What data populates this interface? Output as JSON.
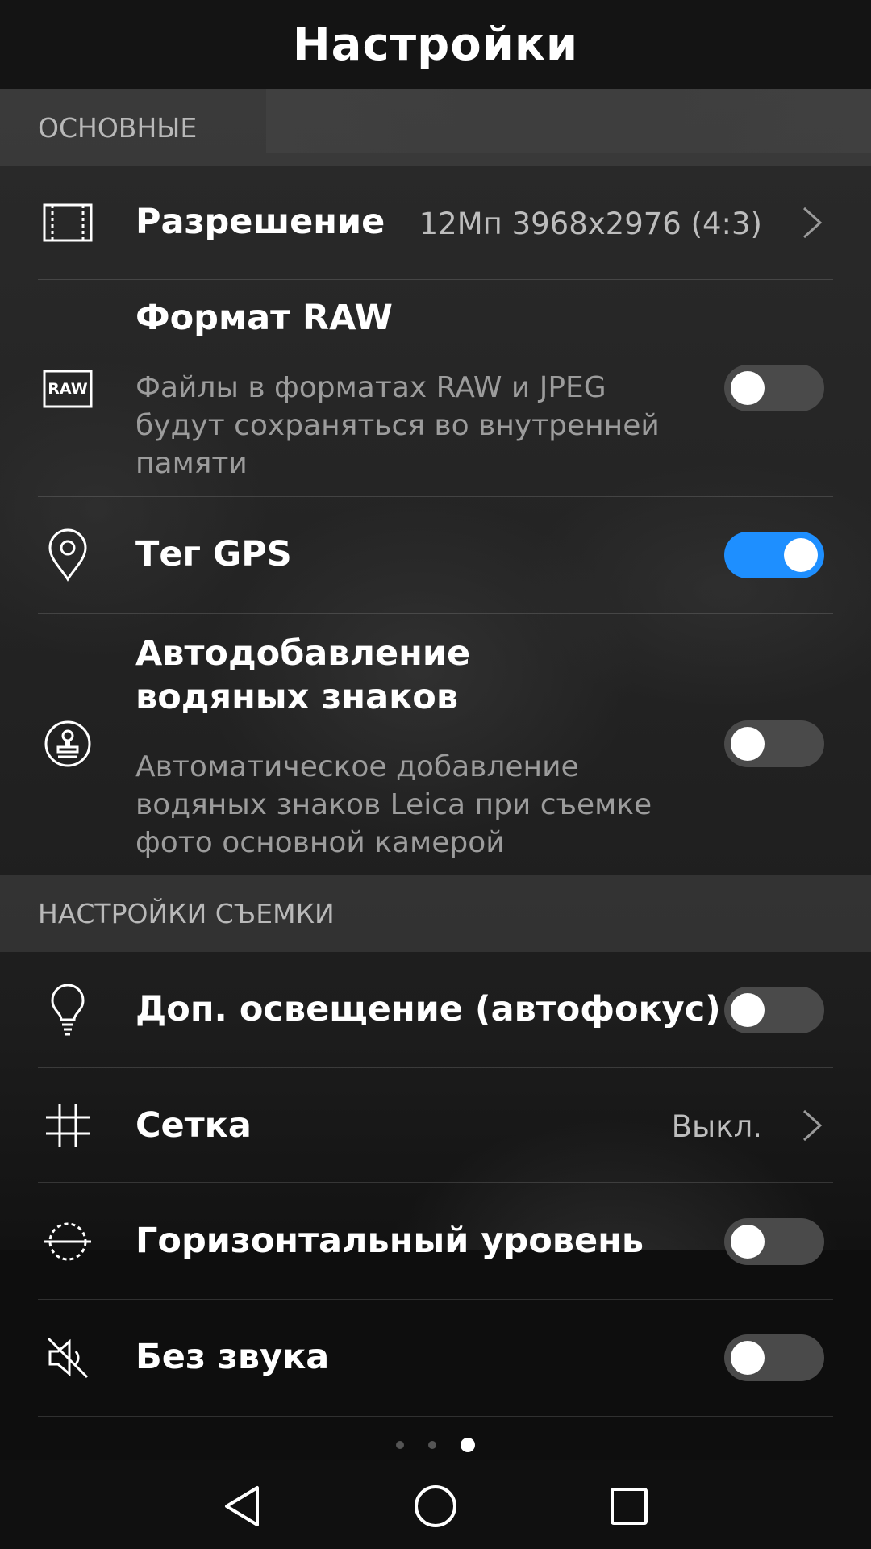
{
  "title": "Настройки",
  "sections": {
    "basic": "ОСНОВНЫЕ",
    "shooting": "НАСТРОЙКИ СЪЕМКИ"
  },
  "items": {
    "resolution": {
      "label": "Разрешение",
      "value": "12Мп 3968x2976 (4:3)",
      "icon": "resolution-frame-icon"
    },
    "raw": {
      "label": "Формат RAW",
      "desc": "Файлы в форматах RAW и JPEG будут сохраняться во внутренней памяти",
      "icon_text": "RAW",
      "toggle": false,
      "icon": "raw-icon"
    },
    "gps": {
      "label": "Тег GPS",
      "toggle": true,
      "icon": "location-pin-icon"
    },
    "watermark": {
      "label": "Автодобавление водяных знаков",
      "desc": "Автоматическое добавление водяных знаков Leica при съемке фото основной камерой",
      "toggle": false,
      "icon": "stamp-icon"
    },
    "light": {
      "label": "Доп. освещение (автофокус)",
      "toggle": false,
      "icon": "light-bulb-icon"
    },
    "grid": {
      "label": "Сетка",
      "value": "Выкл.",
      "icon": "grid-icon"
    },
    "level": {
      "label": "Горизонтальный уровень",
      "toggle": false,
      "icon": "level-icon"
    },
    "mute": {
      "label": "Без звука",
      "toggle": false,
      "icon": "mute-icon"
    }
  },
  "pager": {
    "count": 3,
    "active": 3
  },
  "colors": {
    "accent": "#1e8fff",
    "background": "#0e0e0e"
  }
}
